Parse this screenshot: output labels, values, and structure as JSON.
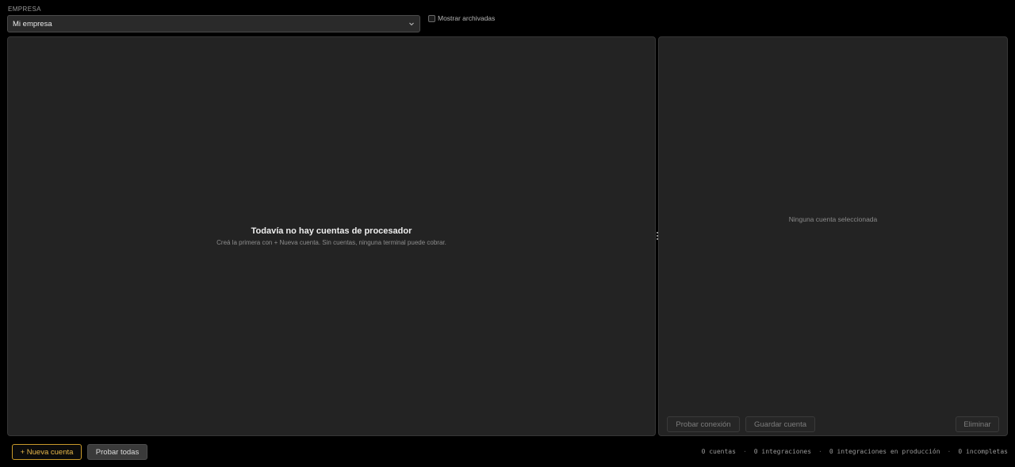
{
  "company": {
    "label": "EMPRESA",
    "selected": "Mi empresa",
    "show_archived_label": "Mostrar archivadas"
  },
  "accounts_panel": {
    "empty_title": "Todavía no hay cuentas de procesador",
    "empty_subtitle": "Creá la primera con + Nueva cuenta. Sin cuentas, ninguna terminal puede cobrar."
  },
  "detail_panel": {
    "empty_text": "Ninguna cuenta seleccionada",
    "test_connection_label": "Probar conexión",
    "save_account_label": "Guardar cuenta",
    "delete_label": "Eliminar"
  },
  "footer": {
    "new_account_label": "+ Nueva cuenta",
    "test_all_label": "Probar todas",
    "stats": {
      "accounts": "0 cuentas",
      "integrations": "0 integraciones",
      "production": "0 integraciones en producción",
      "incomplete": "0 incompletas",
      "separator": "·"
    }
  },
  "colors": {
    "accent": "#e8b84a",
    "background": "#000000",
    "panel": "#232323"
  }
}
